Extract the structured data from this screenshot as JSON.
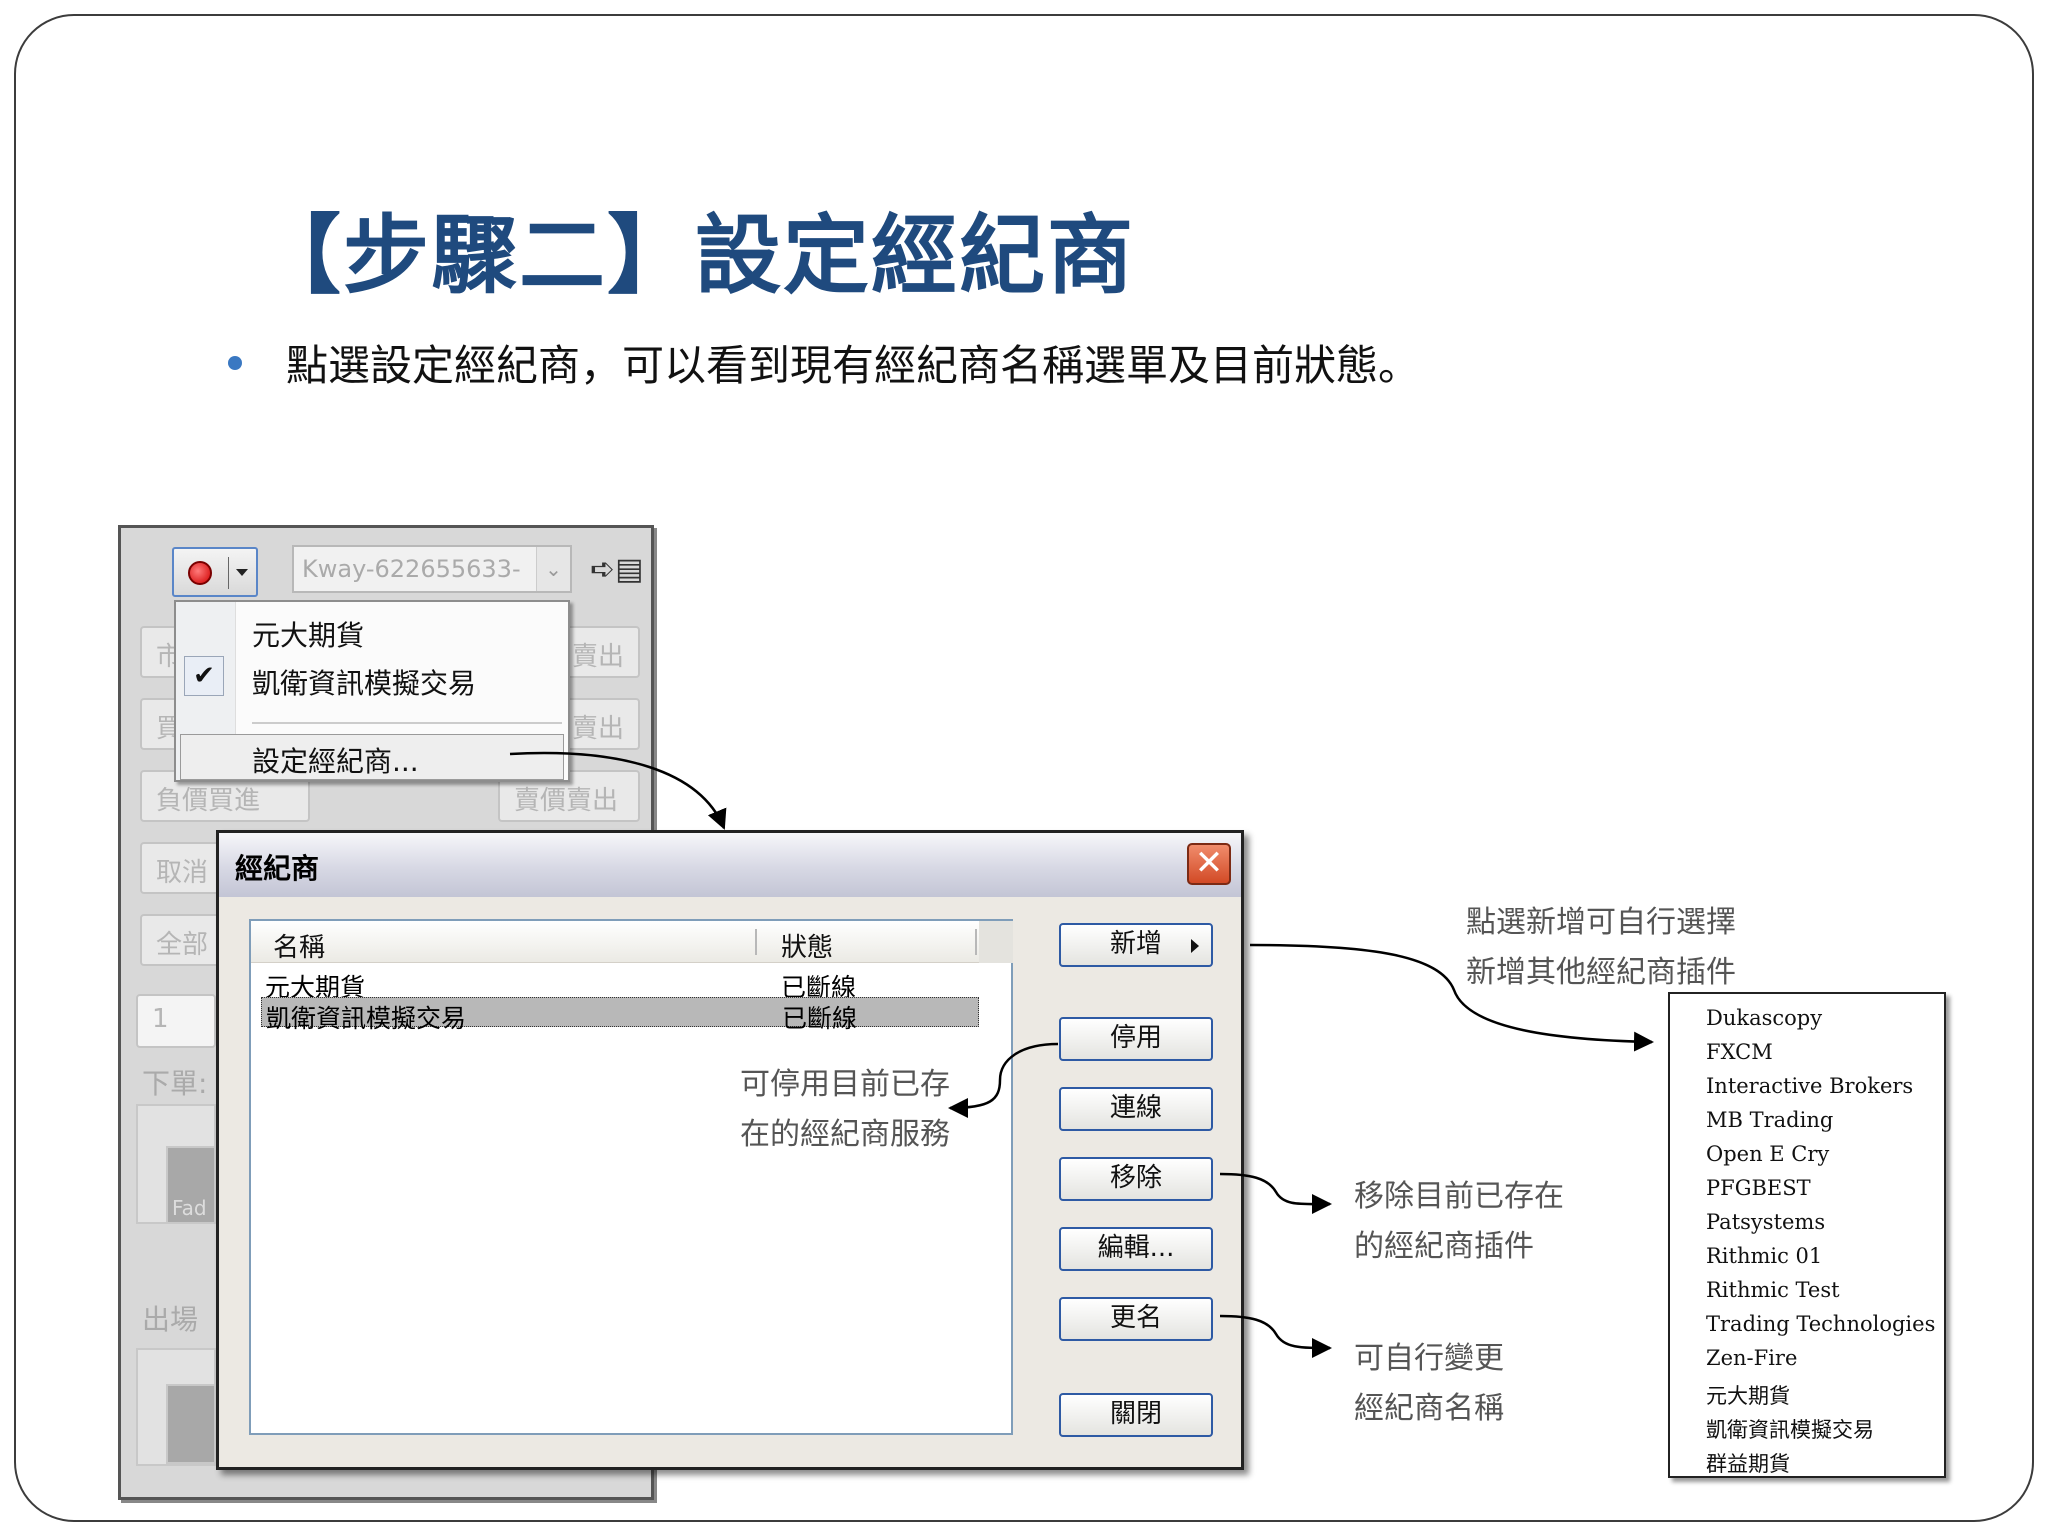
{
  "slide": {
    "title": "【步驟二】設定經紀商",
    "bullet": "點選設定經紀商，可以看到現有經紀商名稱選單及目前狀態。"
  },
  "toolbar": {
    "account_combo": "Kway-622655633-",
    "exit_icon_glyph": "➪▤"
  },
  "background_panel": {
    "button_fragments": [
      "市",
      "買",
      "負價買進",
      "取消",
      "全部"
    ],
    "right_fragments": [
      "賣出",
      "賣出",
      "賣價賣出"
    ],
    "qty_value": "1",
    "order_label": "下單:",
    "exit_label": "出場",
    "icon_fragment": "Fad"
  },
  "menu": {
    "items": [
      "元大期貨",
      "凱衛資訊模擬交易"
    ],
    "checked_index": 1,
    "check_glyph": "✔",
    "action": "設定經紀商..."
  },
  "dialog": {
    "title": "經紀商",
    "close_glyph": "✕",
    "columns": [
      "名稱",
      "狀態"
    ],
    "rows": [
      {
        "name": "元大期貨",
        "status": "已斷線"
      },
      {
        "name": "凱衛資訊模擬交易",
        "status": "已斷線"
      }
    ],
    "buttons": {
      "add": "新增",
      "disable": "停用",
      "connect": "連線",
      "remove": "移除",
      "edit": "編輯...",
      "rename": "更名",
      "close": "關閉"
    }
  },
  "annotations": {
    "add_note": [
      "點選新增可自行選擇",
      "新增其他經紀商插件"
    ],
    "disable_note": [
      "可停用目前已存",
      "在的經紀商服務"
    ],
    "remove_note": [
      "移除目前已存在",
      "的經紀商插件"
    ],
    "rename_note": [
      "可自行變更",
      "經紀商名稱"
    ]
  },
  "broker_list": [
    "Dukascopy",
    "FXCM",
    "Interactive Brokers",
    "MB Trading",
    "Open E Cry",
    "PFGBEST",
    "Patsystems",
    "Rithmic 01",
    "Rithmic Test",
    "Trading Technologies",
    "Zen-Fire",
    "元大期貨",
    "凱衛資訊模擬交易",
    "群益期貨"
  ],
  "colors": {
    "title": "#1f4a7e",
    "bullet": "#3a78c2",
    "button_border": "#2e5aa4",
    "close_button": "#d24a26"
  }
}
